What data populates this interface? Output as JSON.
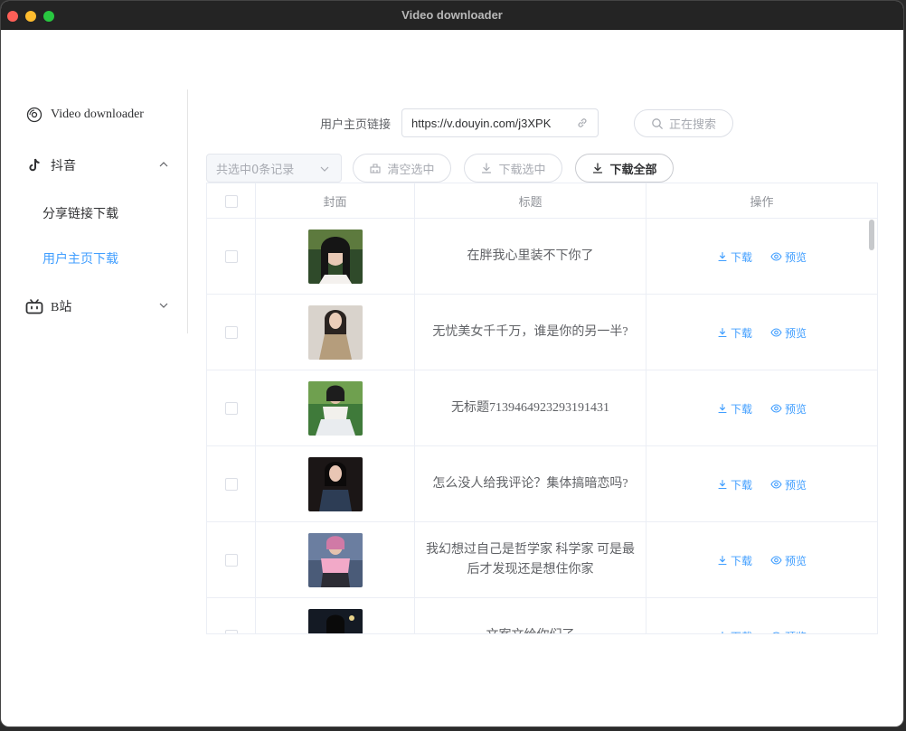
{
  "window": {
    "title": "Video downloader"
  },
  "sidebar": {
    "app": {
      "label": "Video downloader",
      "icon": "disc-icon"
    },
    "douyin": {
      "label": "抖音",
      "icon": "tiktok-icon",
      "expanded": true
    },
    "douyin_items": [
      {
        "label": "分享链接下载",
        "active": false
      },
      {
        "label": "用户主页下载",
        "active": true
      }
    ],
    "bilibili": {
      "label": "B站",
      "icon": "bilibili-tv-icon",
      "expanded": false
    }
  },
  "search": {
    "label": "用户主页链接",
    "value": "https://v.douyin.com/j3XPK",
    "button_label": "正在搜索"
  },
  "toolbar": {
    "select_value": "共选中0条记录",
    "clear_label": "清空选中",
    "download_selected_label": "下载选中",
    "download_all_label": "下载全部"
  },
  "table": {
    "headers": {
      "cover": "封面",
      "title": "标题",
      "actions": "操作"
    },
    "rows": [
      {
        "title": "在胖我心里装不下你了"
      },
      {
        "title": "无忧美女千千万，谁是你的另一半?"
      },
      {
        "title": "无标题7139464923293191431"
      },
      {
        "title": "怎么没人给我评论？集体搞暗恋吗?"
      },
      {
        "title": "我幻想过自己是哲学家 科学家 可是最后才发现还是想住你家"
      },
      {
        "title": "文案文给你们了"
      }
    ],
    "download_label": "下载",
    "preview_label": "预览"
  },
  "colors": {
    "accent": "#409eff",
    "titlebar": "#242424"
  }
}
